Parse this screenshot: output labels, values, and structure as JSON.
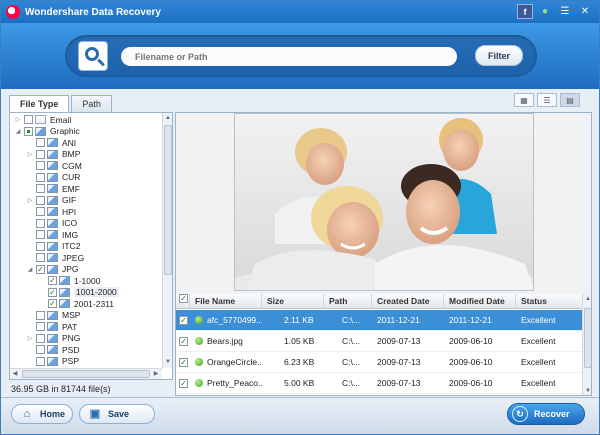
{
  "window": {
    "title": "Wondershare Data Recovery",
    "icons": [
      {
        "name": "facebook-icon",
        "glyph": "f"
      },
      {
        "name": "chat-icon",
        "glyph": "●"
      },
      {
        "name": "menu-icon",
        "glyph": "☰"
      },
      {
        "name": "close-icon",
        "glyph": "✕"
      }
    ]
  },
  "search": {
    "placeholder": "Filename or Path",
    "filter_label": "Filter"
  },
  "tabs": [
    {
      "label": "File Type",
      "active": true
    },
    {
      "label": "Path",
      "active": false
    }
  ],
  "view_modes": [
    "thumbnail-view-icon",
    "list-view-icon",
    "detail-view-icon"
  ],
  "tree": [
    {
      "label": "Email",
      "depth": 0,
      "expand": "▷",
      "check": "none",
      "icon": "mail"
    },
    {
      "label": "Graphic",
      "depth": 0,
      "expand": "◢",
      "check": "partial",
      "icon": "img"
    },
    {
      "label": "ANI",
      "depth": 1,
      "expand": "",
      "check": "none",
      "icon": "img"
    },
    {
      "label": "BMP",
      "depth": 1,
      "expand": "▷",
      "check": "none",
      "icon": "img"
    },
    {
      "label": "CGM",
      "depth": 1,
      "expand": "",
      "check": "none",
      "icon": "img"
    },
    {
      "label": "CUR",
      "depth": 1,
      "expand": "",
      "check": "none",
      "icon": "img"
    },
    {
      "label": "EMF",
      "depth": 1,
      "expand": "",
      "check": "none",
      "icon": "img"
    },
    {
      "label": "GIF",
      "depth": 1,
      "expand": "▷",
      "check": "none",
      "icon": "img"
    },
    {
      "label": "HPI",
      "depth": 1,
      "expand": "",
      "check": "none",
      "icon": "img"
    },
    {
      "label": "ICO",
      "depth": 1,
      "expand": "",
      "check": "none",
      "icon": "img"
    },
    {
      "label": "IMG",
      "depth": 1,
      "expand": "",
      "check": "none",
      "icon": "img"
    },
    {
      "label": "ITC2",
      "depth": 1,
      "expand": "",
      "check": "none",
      "icon": "img"
    },
    {
      "label": "JPEG",
      "depth": 1,
      "expand": "",
      "check": "none",
      "icon": "img"
    },
    {
      "label": "JPG",
      "depth": 1,
      "expand": "◢",
      "check": "checked",
      "icon": "img"
    },
    {
      "label": "1-1000",
      "depth": 2,
      "expand": "",
      "check": "checked",
      "icon": "img"
    },
    {
      "label": "1001-2000",
      "depth": 2,
      "expand": "",
      "check": "checked",
      "icon": "img",
      "highlight": true
    },
    {
      "label": "2001-2311",
      "depth": 2,
      "expand": "",
      "check": "checked",
      "icon": "img"
    },
    {
      "label": "MSP",
      "depth": 1,
      "expand": "",
      "check": "none",
      "icon": "img"
    },
    {
      "label": "PAT",
      "depth": 1,
      "expand": "",
      "check": "none",
      "icon": "img"
    },
    {
      "label": "PNG",
      "depth": 1,
      "expand": "▷",
      "check": "none",
      "icon": "img"
    },
    {
      "label": "PSD",
      "depth": 1,
      "expand": "",
      "check": "none",
      "icon": "img"
    },
    {
      "label": "PSP",
      "depth": 1,
      "expand": "",
      "check": "none",
      "icon": "img"
    }
  ],
  "status": "36.95 GB in 81744 file(s)",
  "table": {
    "columns": [
      "File Name",
      "Size",
      "Path",
      "Created Date",
      "Modified Date",
      "Status"
    ],
    "rows": [
      {
        "name": "afc_5770499...",
        "size": "2.11 KB",
        "path": "C:\\...",
        "created": "2011-12-21",
        "modified": "2011-12-21",
        "status": "Excellent",
        "selected": true
      },
      {
        "name": "Bears.jpg",
        "size": "1.05 KB",
        "path": "C:\\...",
        "created": "2009-07-13",
        "modified": "2009-06-10",
        "status": "Excellent",
        "selected": false
      },
      {
        "name": "OrangeCircle...",
        "size": "6.23 KB",
        "path": "C:\\...",
        "created": "2009-07-13",
        "modified": "2009-06-10",
        "status": "Excellent",
        "selected": false
      },
      {
        "name": "Pretty_Peaco...",
        "size": "5.00 KB",
        "path": "C:\\...",
        "created": "2009-07-13",
        "modified": "2009-06-10",
        "status": "Excellent",
        "selected": false
      }
    ]
  },
  "buttons": {
    "home": "Home",
    "save": "Save",
    "recover": "Recover"
  },
  "colors": {
    "title_bar": "#1d6fc2",
    "selected_row": "#3b8fd6",
    "status_ok": "#3ea21d"
  }
}
